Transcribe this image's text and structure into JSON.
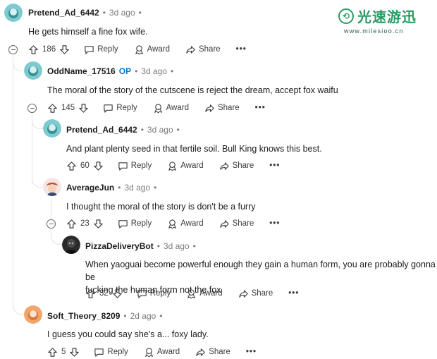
{
  "watermark": {
    "brand": "光速游迅",
    "url": "www.milesioo.cn"
  },
  "actions": {
    "reply": "Reply",
    "award": "Award",
    "share": "Share",
    "more": "•••"
  },
  "comments": [
    {
      "author": "Pretend_Ad_6442",
      "op": "",
      "time": "3d ago",
      "text": "He gets himself a fine fox wife.",
      "votes": "186",
      "avatar_color": "#7ecbcf"
    },
    {
      "author": "OddName_17516",
      "op": "OP",
      "time": "3d ago",
      "text": "The moral of the story of the cutscene is reject the dream, accept fox waifu",
      "votes": "145",
      "avatar_color": "#7ecbcf"
    },
    {
      "author": "Pretend_Ad_6442",
      "op": "",
      "time": "3d ago",
      "text": "And plant plenty seed in that fertile soil. Bull King knows this best.",
      "votes": "60",
      "avatar_color": "#7ecbcf"
    },
    {
      "author": "AverageJun",
      "op": "",
      "time": "3d ago",
      "text": "I thought the moral of the story is don't be a furry",
      "votes": "23",
      "avatar_color": "#c94b3c"
    },
    {
      "author": "PizzaDeliveryBot",
      "op": "",
      "time": "3d ago",
      "text_line1": "When yaoguai become powerful enough they gain a human form, you are probably gonna be",
      "text_line2": "fucking the human form not the fox",
      "votes": "32",
      "avatar_color": "#1c1c1c"
    },
    {
      "author": "Soft_Theory_8209",
      "op": "",
      "time": "2d ago",
      "text": "I guess you could say she's a... foxy lady.",
      "votes": "5",
      "avatar_color": "#f0a66b"
    }
  ]
}
